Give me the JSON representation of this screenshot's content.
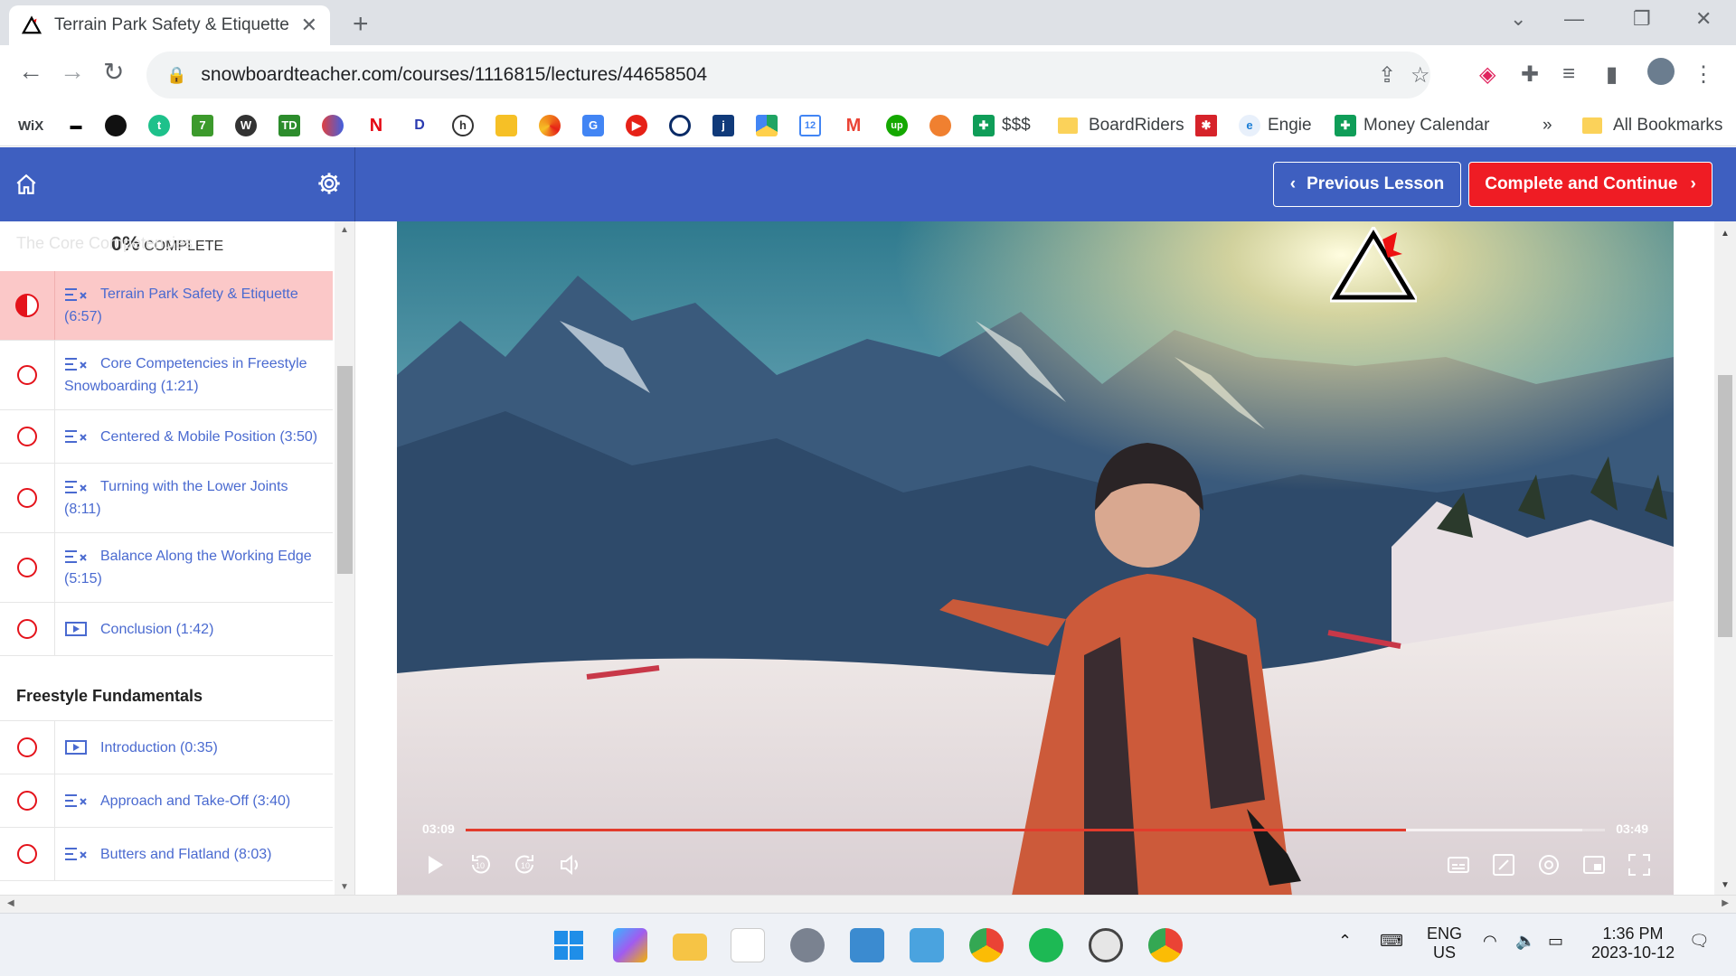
{
  "browser": {
    "tab_title": "Terrain Park Safety & Etiquette |",
    "tab_close": "✕",
    "new_tab": "+",
    "url": "snowboardteacher.com/courses/1116815/lectures/44658504",
    "bookmarks": [
      {
        "label": "WiX",
        "color": "#ffffff",
        "text": "#000"
      },
      {
        "label": "",
        "icon": "dash-icon"
      },
      {
        "label": "",
        "icon": "circle-icon",
        "color": "#111"
      },
      {
        "label": "",
        "icon": "t-icon",
        "color": "#1ec18b"
      },
      {
        "label": "",
        "icon": "seven-icon",
        "color": "#3c9a2c"
      },
      {
        "label": "",
        "icon": "wordpress-icon",
        "color": "#333"
      },
      {
        "label": "",
        "icon": "td-icon",
        "color": "#2c8c2c"
      },
      {
        "label": "",
        "icon": "gradient-icon",
        "color": "#e04040"
      },
      {
        "label": "",
        "icon": "netflix-icon",
        "color": "#e50914"
      },
      {
        "label": "",
        "icon": "disney-icon",
        "color": "#2a3ab0"
      },
      {
        "label": "",
        "icon": "h-icon",
        "color": "#555"
      },
      {
        "label": "",
        "icon": "keep-icon",
        "color": "#f6c026"
      },
      {
        "label": "",
        "icon": "pinwheel-icon",
        "color": "#f07d1a"
      },
      {
        "label": "",
        "icon": "translate-icon",
        "color": "#4285f4"
      },
      {
        "label": "",
        "icon": "youtube-icon",
        "color": "#e62117"
      },
      {
        "label": "",
        "icon": "ring-icon",
        "color": "#0a2b66"
      },
      {
        "label": "",
        "icon": "j-icon",
        "color": "#103a7a"
      },
      {
        "label": "",
        "icon": "drive-icon",
        "color": "#1fa463"
      },
      {
        "label": "",
        "icon": "calendar-icon",
        "color": "#4285f4"
      },
      {
        "label": "",
        "icon": "gmail-icon",
        "color": "#ea4335"
      },
      {
        "label": "",
        "icon": "upwork-icon",
        "color": "#14a800"
      },
      {
        "label": "",
        "icon": "orange-dot-icon",
        "color": "#f08030"
      },
      {
        "label": "$$$",
        "icon": "sheets-icon",
        "color": "#0f9d58"
      },
      {
        "label": "BoardRiders",
        "icon": "folder-icon",
        "color": "#fbd25a"
      },
      {
        "label": "",
        "icon": "red-square-icon",
        "color": "#d6232a"
      },
      {
        "label": "Engie",
        "icon": "engie-icon",
        "color": "#1c7ed6"
      },
      {
        "label": "Money Calendar",
        "icon": "sheets-icon",
        "color": "#0f9d58"
      }
    ],
    "more_bookmarks": "»",
    "all_bookmarks": "All Bookmarks"
  },
  "header": {
    "progress_pct": "0%",
    "progress_label": "COMPLETE",
    "ghost_section": "The Core Competencies",
    "prev_label": "Previous Lesson",
    "next_label": "Complete and Continue"
  },
  "lectures": [
    {
      "title": "Terrain Park Safety & Etiquette (6:57)",
      "icon": "quiz-icon",
      "status": "in-progress"
    },
    {
      "title": "Core Competencies in Freestyle Snowboarding (1:21)",
      "icon": "quiz-icon",
      "status": "not-started"
    },
    {
      "title": "Centered & Mobile Position (3:50)",
      "icon": "quiz-icon",
      "status": "not-started"
    },
    {
      "title": "Turning with the Lower Joints (8:11)",
      "icon": "quiz-icon",
      "status": "not-started"
    },
    {
      "title": "Balance Along the Working Edge (5:15)",
      "icon": "quiz-icon",
      "status": "not-started"
    },
    {
      "title": "Conclusion (1:42)",
      "icon": "video-icon",
      "status": "not-started"
    }
  ],
  "section2": {
    "title": "Freestyle Fundamentals",
    "lectures": [
      {
        "title": "Introduction (0:35)",
        "icon": "video-icon"
      },
      {
        "title": "Approach and Take-Off (3:40)",
        "icon": "quiz-icon"
      },
      {
        "title": "Butters and Flatland (8:03)",
        "icon": "quiz-icon"
      }
    ]
  },
  "video": {
    "current_time": "03:09",
    "duration": "03:49",
    "played_fraction": 0.825,
    "buffered_fraction": 0.98
  },
  "taskbar": {
    "lang": "ENG",
    "region": "US",
    "time": "1:36 PM",
    "date": "2023-10-12"
  },
  "colors": {
    "brand_blue": "#3e5fc0",
    "accent_red": "#ef1c24",
    "link_blue": "#4a6ad0"
  }
}
